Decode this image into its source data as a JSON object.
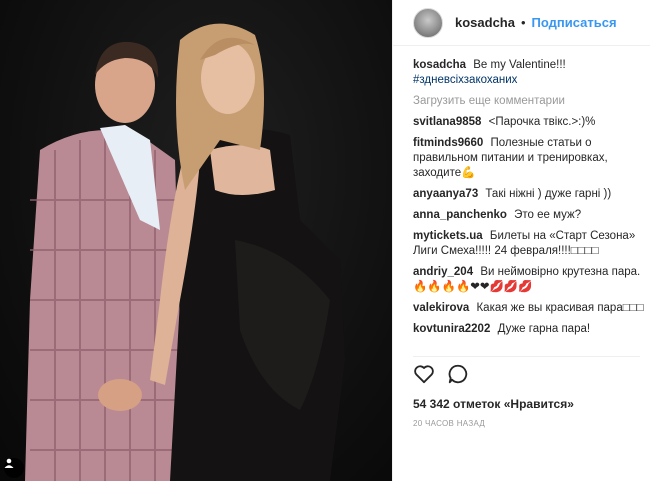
{
  "post": {
    "author": "kosadcha",
    "separator": "•",
    "follow_label": "Подписаться",
    "caption": "Be my Valentine!!!",
    "hashtag": "#здневсіхзакоханих",
    "load_more": "Загрузить еще комментарии"
  },
  "comments": [
    {
      "user": "svitlana9858",
      "text": "<Парочка твікс.>:)%"
    },
    {
      "user": "fitminds9660",
      "text": "Полезные статьи о правильном питании и тренировках, заходите💪"
    },
    {
      "user": "anyaanya73",
      "text": "Такі ніжні ) дуже гарні ))"
    },
    {
      "user": "anna_panchenko",
      "text": "Это ее муж?"
    },
    {
      "user": "mytickets.ua",
      "text": "Билеты на «Старт Сезона» Лиги Смеха!!!!! 24 февраля!!!!□□□□"
    },
    {
      "user": "andriy_204",
      "text": "Ви неймовірно крутезна пара. 🔥🔥🔥🔥❤❤💋💋💋"
    },
    {
      "user": "valekirova",
      "text": "Какая же вы красивая пара□□□"
    },
    {
      "user": "kovtunira2202",
      "text": "Дуже гарна пара!"
    }
  ],
  "actions": {
    "like_icon": "heart-outline",
    "comment_icon": "speech-bubble",
    "likes_text": "54 342 отметок «Нравится»",
    "time_text": "20 ЧАСОВ НАЗАД"
  },
  "colors": {
    "link": "#3897f0",
    "hashtag": "#003569",
    "muted": "#999999"
  }
}
